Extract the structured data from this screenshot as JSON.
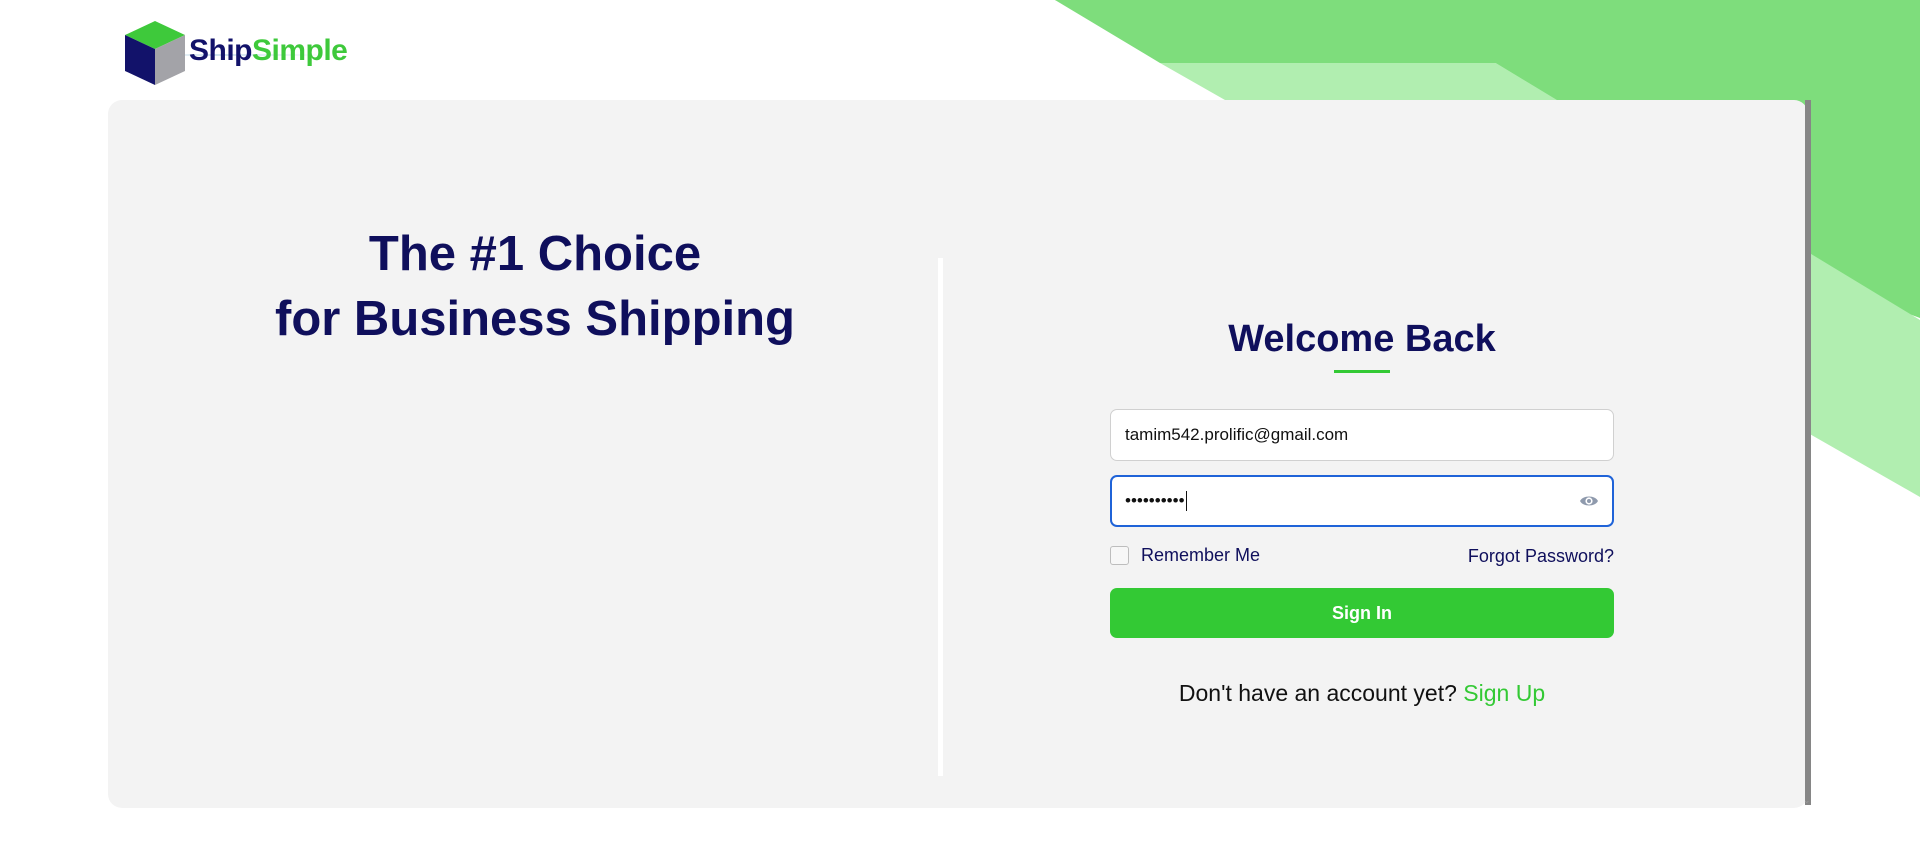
{
  "brand": {
    "name_part1": "Ship",
    "name_part2": "Simple",
    "colors": {
      "navy": "#0f0f5c",
      "green": "#33c934",
      "light_green": "#7edd7c",
      "pale_green": "#b1eeb0"
    }
  },
  "hero": {
    "line1": "The #1 Choice",
    "line2": "for Business Shipping"
  },
  "login": {
    "title": "Welcome Back",
    "email_value": "tamim542.prolific@gmail.com",
    "password_masked": "••••••••••",
    "password_toggle_icon": "eye-icon",
    "remember_label": "Remember Me",
    "remember_checked": false,
    "forgot_label": "Forgot Password?",
    "signin_label": "Sign In",
    "no_account_text": "Don't have an account yet?",
    "signup_label": "Sign Up"
  }
}
